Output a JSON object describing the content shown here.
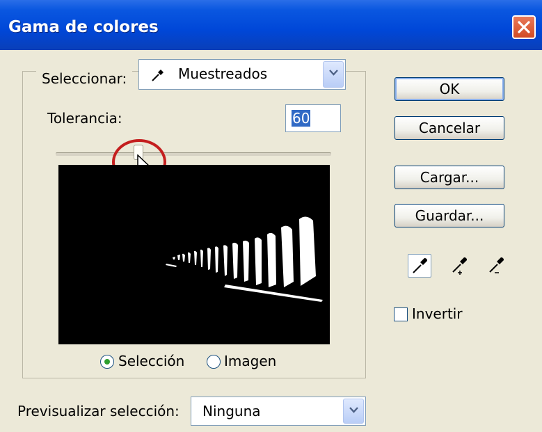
{
  "window": {
    "title": "Gama de colores"
  },
  "select": {
    "label": "Seleccionar:",
    "value": "Muestreados",
    "icon": "eyedropper-icon"
  },
  "tolerance": {
    "label": "Tolerancia:",
    "value": "60",
    "slider_value": 60,
    "slider_max": 200
  },
  "view_options": {
    "selection_label": "Selección",
    "image_label": "Imagen",
    "selected": "Selección"
  },
  "preview_selection": {
    "label": "Previsualizar selección:",
    "value": "Ninguna"
  },
  "buttons": {
    "ok": "OK",
    "cancel": "Cancelar",
    "load": "Cargar...",
    "save": "Guardar..."
  },
  "tools": [
    "eyedropper-icon",
    "eyedropper-plus-icon",
    "eyedropper-minus-icon"
  ],
  "invert": {
    "label": "Invertir",
    "checked": false
  },
  "colors": {
    "titlebar": "#0047d8",
    "close": "#d24a23",
    "highlight": "#c41e1e",
    "dialog": "#ece9d8"
  }
}
